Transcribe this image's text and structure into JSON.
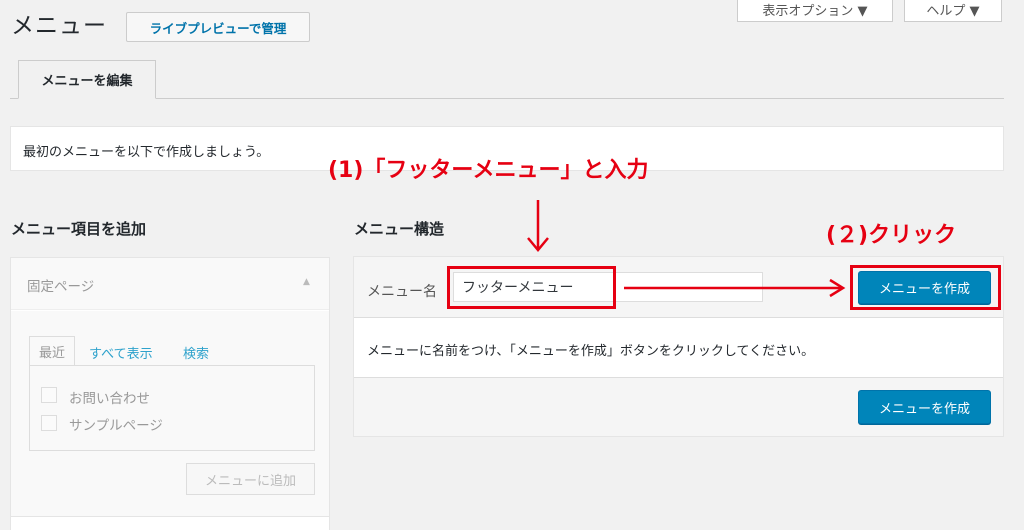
{
  "header": {
    "screen_options_label": "表示オプション ▼",
    "help_label": "ヘルプ ▼",
    "title": "メニュー",
    "live_preview_label": "ライブプレビューで管理"
  },
  "tabs": [
    {
      "label": "メニューを編集",
      "active": true
    }
  ],
  "notice": "最初のメニューを以下で作成しましょう。",
  "add_items": {
    "title": "メニュー項目を追加",
    "section_title": "固定ページ",
    "tabs": [
      "最近",
      "すべて表示",
      "検索"
    ],
    "items": [
      {
        "label": "お問い合わせ",
        "checked": false
      },
      {
        "label": "サンプルページ",
        "checked": false
      }
    ],
    "add_button_label": "メニューに追加"
  },
  "menu_structure": {
    "title": "メニュー構造",
    "name_label": "メニュー名",
    "name_value": "フッターメニュー",
    "create_button_label": "メニューを作成",
    "instruction": "メニューに名前をつけ、「メニューを作成」ボタンをクリックしてください。"
  },
  "annotations": {
    "step1": "(1)「フッターメニュー」と入力",
    "step2": "(２)クリック",
    "color": "#e60012"
  },
  "colors": {
    "primary_button": "#0085ba",
    "link": "#2ea2cc",
    "background": "#f1f1f1"
  }
}
